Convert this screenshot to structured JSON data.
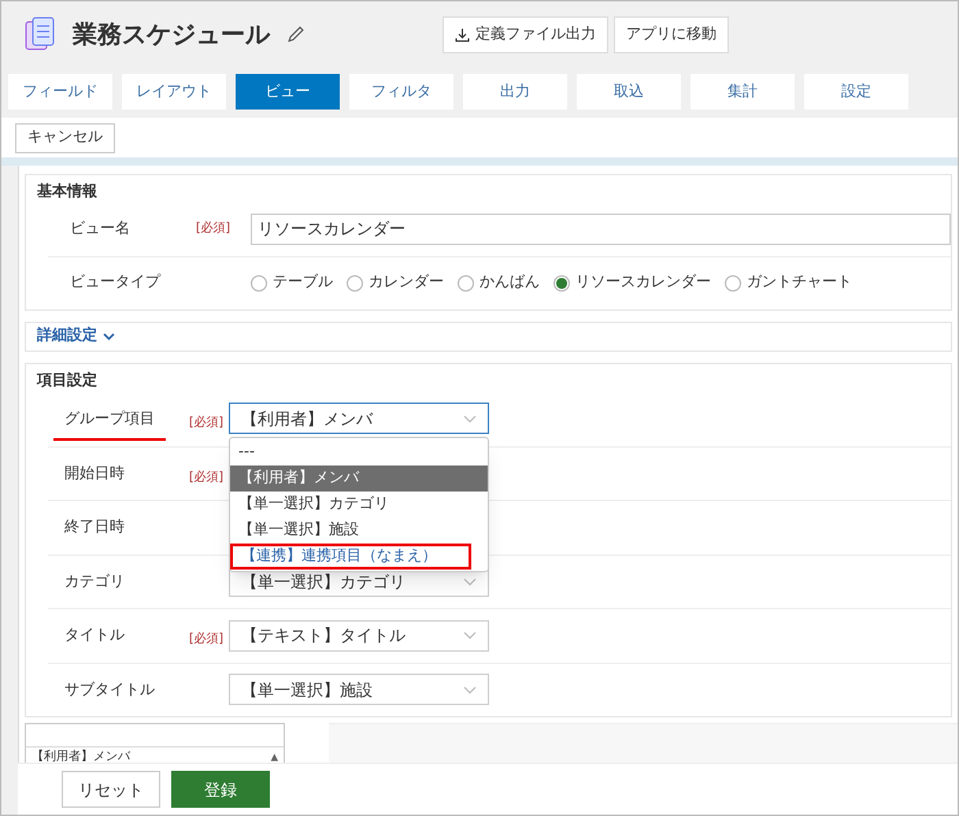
{
  "header": {
    "title": "業務スケジュール",
    "buttons": [
      "定義ファイル出力",
      "アプリに移動"
    ]
  },
  "tabs": [
    {
      "label": "フィールド",
      "selected": false
    },
    {
      "label": "レイアウト",
      "selected": false
    },
    {
      "label": "ビュー",
      "selected": true
    },
    {
      "label": "フィルタ",
      "selected": false
    },
    {
      "label": "出力",
      "selected": false
    },
    {
      "label": "取込",
      "selected": false
    },
    {
      "label": "集計",
      "selected": false
    },
    {
      "label": "設定",
      "selected": false
    }
  ],
  "cancel_button": "キャンセル",
  "basic": {
    "title": "基本情報",
    "view_name": {
      "label": "ビュー名",
      "required": "[必須]",
      "value": "リソースカレンダー"
    },
    "view_type": {
      "label": "ビュータイプ",
      "options": [
        {
          "label": "テーブル",
          "selected": false
        },
        {
          "label": "カレンダー",
          "selected": false
        },
        {
          "label": "かんばん",
          "selected": false
        },
        {
          "label": "リソースカレンダー",
          "selected": true
        },
        {
          "label": "ガントチャート",
          "selected": false
        }
      ]
    }
  },
  "details_toggle": "詳細設定",
  "items": {
    "title": "項目設定",
    "fields": [
      {
        "label": "グループ項目",
        "required": "[必須]",
        "value": "【利用者】メンバ",
        "underlined": true,
        "open": true
      },
      {
        "label": "開始日時",
        "required": "[必須]",
        "underlined": false
      },
      {
        "label": "終了日時",
        "underlined": false
      },
      {
        "label": "カテゴリ",
        "value": "【単一選択】カテゴリ",
        "underlined": false
      },
      {
        "label": "タイトル",
        "required": "[必須]",
        "value": "【テキスト】タイトル",
        "underlined": false
      },
      {
        "label": "サブタイトル",
        "value": "【単一選択】施設",
        "underlined": false
      }
    ],
    "dropdown": [
      {
        "label": "---",
        "selected": false,
        "highlighted": false
      },
      {
        "label": "【利用者】メンバ",
        "selected": true,
        "highlighted": false
      },
      {
        "label": "【単一選択】カテゴリ",
        "selected": false,
        "highlighted": false
      },
      {
        "label": "【単一選択】施設",
        "selected": false,
        "highlighted": false
      },
      {
        "label": "【連携】連携項目（なまえ）",
        "selected": false,
        "highlighted": true
      }
    ]
  },
  "list_box": {
    "item": "【利用者】メンバ",
    "scroll_icon": "▲"
  },
  "footer": {
    "reset": "リセット",
    "submit": "登録"
  }
}
